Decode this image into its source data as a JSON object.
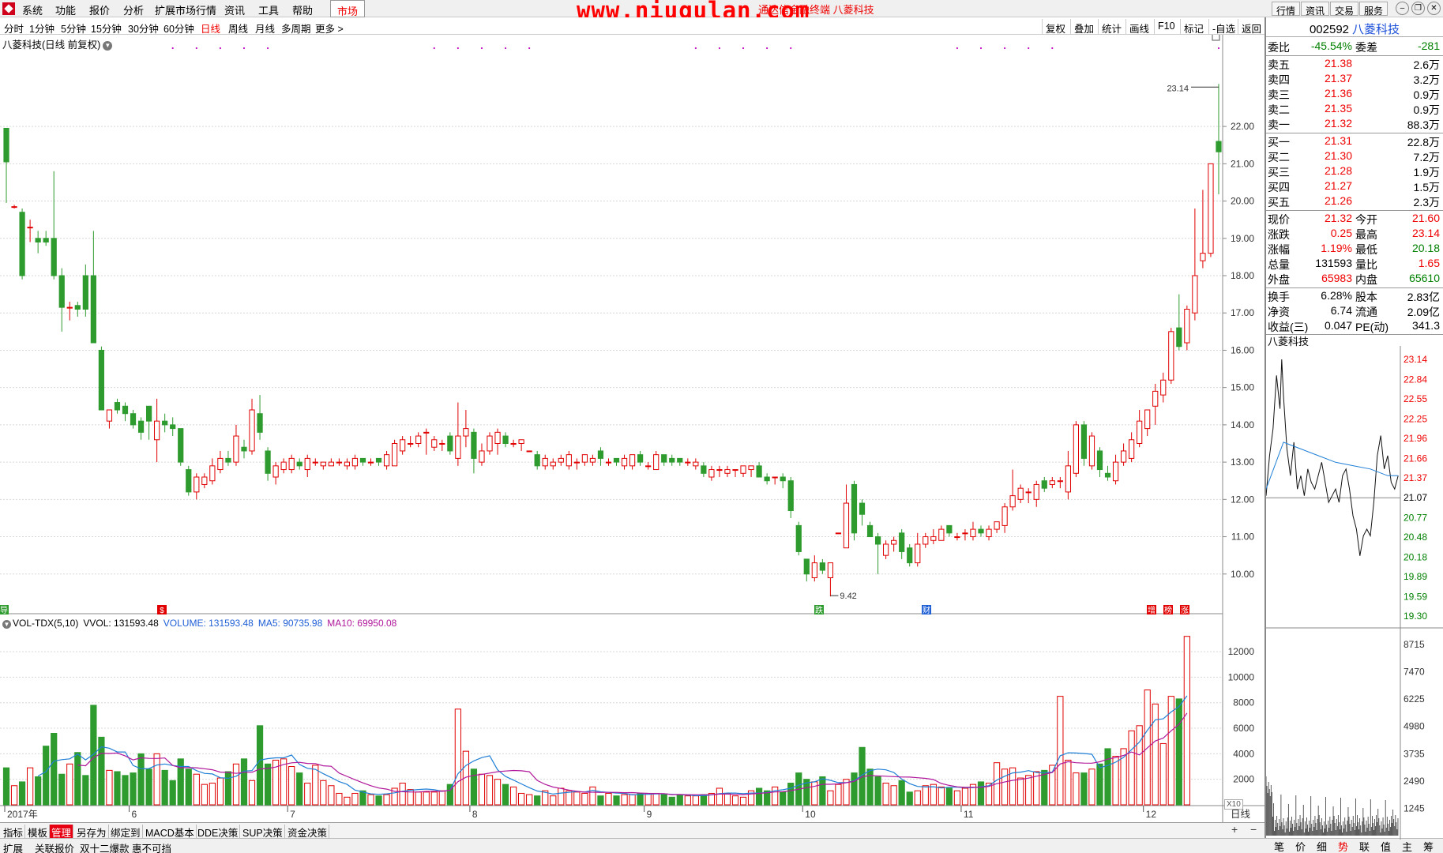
{
  "menu": {
    "items": [
      "系统",
      "功能",
      "报价",
      "分析",
      "扩展市场行情",
      "资讯",
      "工具",
      "帮助"
    ],
    "active": "市场",
    "watermark": "www.niugulan.com",
    "ticker": "通达信金融终端  八菱科技",
    "right_buttons": [
      "行情",
      "资讯",
      "交易",
      "服务"
    ]
  },
  "periods": {
    "items": [
      "分时",
      "1分钟",
      "5分钟",
      "15分钟",
      "30分钟",
      "60分钟",
      "日线",
      "周线",
      "月线",
      "多周期",
      "更多 >"
    ],
    "active": "日线"
  },
  "toolbar": [
    "复权",
    "叠加",
    "统计",
    "画线",
    "F10",
    "标记",
    "-自选",
    "返回"
  ],
  "chart": {
    "title": "八菱科技(日线 前复权)",
    "high_marker": "23.14",
    "low_marker": "9.42",
    "markers": {
      "left": "导",
      "s": "$",
      "die": "跌",
      "cai": "财",
      "zeng": "增",
      "bang": "榜",
      "zhang": "涨"
    },
    "price_ticks": [
      "22.00",
      "21.00",
      "20.00",
      "19.00",
      "18.00",
      "17.00",
      "16.00",
      "15.00",
      "14.00",
      "13.00",
      "12.00",
      "11.00",
      "10.00"
    ],
    "vol_ticks": [
      "12000",
      "10000",
      "8000",
      "6000",
      "4000",
      "2000"
    ],
    "vol_unit": "X10",
    "x_labels": [
      "2017年",
      "6",
      "7",
      "8",
      "9",
      "10",
      "11",
      "12"
    ],
    "x_axis_unit": "日线"
  },
  "volume_header": {
    "name": "VOL-TDX(5,10)",
    "vvol": "VVOL: 131593.48",
    "volume": "VOLUME: 131593.48",
    "ma5": "MA5: 90735.98",
    "ma10": "MA10: 69950.08"
  },
  "bottom_tabs": [
    "指标",
    "模板",
    "管理",
    "另存为",
    "绑定到",
    "MACD基本",
    "DDE决策",
    "SUP决策",
    "资金决策"
  ],
  "bottom_tabs_active": "管理",
  "status_items": [
    "扩展",
    "关联报价",
    "双十二爆款 惠不可挡"
  ],
  "quote": {
    "code": "002592",
    "name": "八菱科技",
    "weibi_label": "委比",
    "weibi": "-45.54%",
    "weicha_label": "委差",
    "weicha": "-281",
    "sells": [
      {
        "label": "卖五",
        "price": "21.38",
        "vol": "2.6万"
      },
      {
        "label": "卖四",
        "price": "21.37",
        "vol": "3.2万"
      },
      {
        "label": "卖三",
        "price": "21.36",
        "vol": "0.9万"
      },
      {
        "label": "卖二",
        "price": "21.35",
        "vol": "0.9万"
      },
      {
        "label": "卖一",
        "price": "21.32",
        "vol": "88.3万"
      }
    ],
    "buys": [
      {
        "label": "买一",
        "price": "21.31",
        "vol": "22.8万"
      },
      {
        "label": "买二",
        "price": "21.30",
        "vol": "7.2万"
      },
      {
        "label": "买三",
        "price": "21.28",
        "vol": "1.9万"
      },
      {
        "label": "买四",
        "price": "21.27",
        "vol": "1.5万"
      },
      {
        "label": "买五",
        "price": "21.26",
        "vol": "2.3万"
      }
    ],
    "stats": [
      {
        "l1": "现价",
        "v1": "21.32",
        "c1": "red",
        "l2": "今开",
        "v2": "21.60",
        "c2": "red"
      },
      {
        "l1": "涨跌",
        "v1": "0.25",
        "c1": "red",
        "l2": "最高",
        "v2": "23.14",
        "c2": "red"
      },
      {
        "l1": "涨幅",
        "v1": "1.19%",
        "c1": "red",
        "l2": "最低",
        "v2": "20.18",
        "c2": "green"
      },
      {
        "l1": "总量",
        "v1": "131593",
        "c1": "black",
        "l2": "量比",
        "v2": "1.65",
        "c2": "red"
      },
      {
        "l1": "外盘",
        "v1": "65983",
        "c1": "red",
        "l2": "内盘",
        "v2": "65610",
        "c2": "green"
      }
    ],
    "fund": [
      {
        "l1": "换手",
        "v1": "6.28%",
        "l2": "股本",
        "v2": "2.83亿"
      },
      {
        "l1": "净资",
        "v1": "6.74",
        "l2": "流通",
        "v2": "2.09亿"
      },
      {
        "l1": "收益(三)",
        "v1": "0.047",
        "l2": "PE(动)",
        "v2": "341.3"
      }
    ]
  },
  "intraday": {
    "title": "八菱科技",
    "price_ticks": [
      "23.14",
      "22.84",
      "22.55",
      "22.25",
      "21.96",
      "21.66",
      "21.37",
      "21.07",
      "20.77",
      "20.48",
      "20.18",
      "19.89",
      "19.59",
      "19.30"
    ],
    "vol_ticks": [
      "8715",
      "7470",
      "6225",
      "4980",
      "3735",
      "2490",
      "1245"
    ]
  },
  "intraday_tabs": [
    "笔",
    "价",
    "细",
    "势",
    "联",
    "值",
    "主",
    "筹"
  ],
  "intraday_tabs_active": "势",
  "colors": {
    "up": "#e00000",
    "down": "#2e9b2e",
    "ma5": "#1f7fd6",
    "ma10": "#b0179b",
    "accent": "#e60012"
  },
  "chart_data": {
    "type": "candlestick",
    "title": "八菱科技(日线 前复权)",
    "ylim": [
      9.0,
      23.4
    ],
    "x_months": [
      "2017年",
      "6",
      "7",
      "8",
      "9",
      "10",
      "11",
      "12"
    ],
    "candles": [
      [
        21.95,
        21.05,
        21.95,
        19.95
      ],
      [
        19.85,
        19.85,
        19.9,
        19.8
      ],
      [
        19.7,
        18.0,
        19.8,
        17.9
      ],
      [
        19.3,
        19.3,
        19.5,
        18.9
      ],
      [
        19.0,
        18.9,
        19.2,
        18.6
      ],
      [
        19.0,
        18.9,
        19.2,
        18.8
      ],
      [
        19.0,
        18.0,
        20.8,
        17.9
      ],
      [
        18.0,
        17.15,
        18.2,
        16.5
      ],
      [
        17.15,
        17.15,
        17.3,
        16.8
      ],
      [
        17.2,
        17.1,
        17.3,
        16.9
      ],
      [
        18.0,
        17.1,
        18.3,
        16.9
      ],
      [
        18.0,
        16.2,
        19.2,
        16.2
      ],
      [
        16.0,
        14.4,
        16.1,
        14.4
      ],
      [
        14.1,
        14.4,
        14.4,
        13.9
      ],
      [
        14.6,
        14.4,
        14.7,
        14.3
      ],
      [
        14.5,
        14.3,
        14.6,
        14.1
      ],
      [
        14.3,
        14.0,
        14.4,
        13.9
      ],
      [
        14.1,
        13.8,
        14.2,
        13.6
      ],
      [
        14.5,
        14.1,
        14.5,
        13.6
      ],
      [
        13.6,
        14.1,
        14.7,
        13.0
      ],
      [
        14.1,
        14.0,
        14.3,
        13.8
      ],
      [
        14.0,
        13.9,
        14.2,
        13.7
      ],
      [
        13.9,
        13.0,
        13.9,
        12.9
      ],
      [
        12.8,
        12.2,
        12.9,
        12.1
      ],
      [
        12.2,
        12.6,
        12.7,
        12.0
      ],
      [
        12.4,
        12.6,
        12.7,
        12.3
      ],
      [
        12.5,
        12.9,
        13.1,
        12.4
      ],
      [
        12.8,
        13.1,
        13.3,
        12.7
      ],
      [
        13.1,
        13.0,
        13.3,
        12.9
      ],
      [
        13.0,
        13.7,
        14.0,
        12.9
      ],
      [
        13.4,
        13.3,
        13.6,
        13.1
      ],
      [
        13.3,
        14.4,
        14.7,
        13.2
      ],
      [
        14.3,
        13.8,
        14.8,
        13.6
      ],
      [
        13.3,
        12.7,
        13.4,
        12.5
      ],
      [
        12.6,
        12.9,
        13.0,
        12.4
      ],
      [
        12.8,
        13.0,
        13.1,
        12.7
      ],
      [
        12.8,
        13.1,
        13.2,
        12.7
      ],
      [
        13.0,
        12.9,
        13.1,
        12.8
      ],
      [
        12.8,
        13.1,
        13.2,
        12.6
      ],
      [
        13.0,
        13.0,
        13.1,
        12.9
      ],
      [
        12.9,
        13.0,
        13.0,
        12.8
      ],
      [
        12.9,
        13.0,
        13.1,
        12.9
      ],
      [
        13.0,
        13.0,
        13.1,
        12.9
      ],
      [
        12.9,
        13.0,
        13.1,
        12.8
      ],
      [
        12.9,
        13.1,
        13.2,
        12.8
      ],
      [
        13.1,
        13.0,
        13.1,
        12.9
      ],
      [
        13.0,
        13.0,
        13.1,
        12.9
      ],
      [
        13.1,
        13.0,
        13.1,
        12.9
      ],
      [
        12.9,
        13.2,
        13.3,
        12.8
      ],
      [
        12.9,
        13.5,
        13.6,
        12.9
      ],
      [
        13.3,
        13.6,
        13.7,
        13.2
      ],
      [
        13.5,
        13.5,
        13.7,
        13.4
      ],
      [
        13.5,
        13.7,
        13.8,
        13.4
      ],
      [
        13.8,
        13.8,
        13.9,
        13.2
      ],
      [
        13.4,
        13.6,
        13.7,
        13.3
      ],
      [
        13.5,
        13.5,
        13.6,
        13.3
      ],
      [
        13.7,
        13.3,
        13.8,
        13.2
      ],
      [
        13.1,
        13.7,
        14.6,
        12.9
      ],
      [
        13.7,
        13.9,
        14.4,
        13.4
      ],
      [
        13.8,
        13.1,
        13.9,
        12.7
      ],
      [
        13.0,
        13.3,
        13.5,
        12.9
      ],
      [
        13.3,
        13.7,
        13.8,
        13.2
      ],
      [
        13.5,
        13.8,
        13.9,
        13.2
      ],
      [
        13.7,
        13.5,
        13.8,
        13.4
      ],
      [
        13.5,
        13.5,
        13.6,
        13.4
      ],
      [
        13.5,
        13.6,
        13.6,
        13.3
      ],
      [
        13.3,
        13.3,
        13.3,
        13.3
      ],
      [
        13.2,
        12.9,
        13.3,
        12.8
      ],
      [
        12.9,
        13.1,
        13.2,
        12.8
      ],
      [
        12.9,
        13.0,
        13.1,
        12.8
      ],
      [
        13.0,
        13.1,
        13.2,
        12.9
      ],
      [
        12.9,
        13.2,
        13.3,
        12.8
      ],
      [
        13.0,
        13.0,
        13.1,
        12.8
      ],
      [
        13.0,
        13.2,
        13.2,
        12.9
      ],
      [
        13.0,
        13.1,
        13.2,
        12.9
      ],
      [
        13.3,
        13.1,
        13.4,
        12.9
      ],
      [
        13.0,
        13.0,
        13.1,
        12.9
      ],
      [
        13.1,
        13.0,
        13.1,
        12.9
      ],
      [
        12.9,
        13.1,
        13.2,
        12.8
      ],
      [
        12.9,
        13.2,
        13.2,
        12.8
      ],
      [
        13.2,
        13.0,
        13.3,
        12.9
      ],
      [
        12.9,
        12.9,
        13.0,
        12.8
      ],
      [
        12.8,
        13.2,
        13.3,
        12.8
      ],
      [
        13.2,
        13.0,
        13.2,
        12.9
      ],
      [
        13.1,
        13.0,
        13.2,
        12.9
      ],
      [
        13.1,
        13.0,
        13.1,
        12.9
      ],
      [
        13.0,
        13.0,
        13.1,
        12.9
      ],
      [
        12.9,
        13.0,
        13.1,
        12.8
      ],
      [
        12.9,
        12.7,
        13.0,
        12.6
      ],
      [
        12.6,
        12.8,
        12.9,
        12.5
      ],
      [
        12.8,
        12.8,
        12.9,
        12.6
      ],
      [
        12.7,
        12.8,
        12.9,
        12.6
      ],
      [
        12.8,
        12.8,
        12.8,
        12.6
      ],
      [
        12.7,
        12.9,
        12.9,
        12.6
      ],
      [
        12.8,
        12.9,
        12.9,
        12.6
      ],
      [
        12.9,
        12.6,
        13.0,
        12.6
      ],
      [
        12.6,
        12.5,
        12.7,
        12.4
      ],
      [
        12.6,
        12.6,
        12.6,
        12.4
      ],
      [
        12.6,
        12.5,
        12.7,
        12.3
      ],
      [
        12.5,
        11.7,
        12.6,
        11.5
      ],
      [
        11.3,
        10.6,
        11.4,
        10.5
      ],
      [
        10.4,
        10.0,
        10.4,
        9.8
      ],
      [
        9.9,
        10.3,
        10.5,
        9.8
      ],
      [
        10.3,
        10.1,
        10.4,
        10.0
      ],
      [
        9.9,
        10.3,
        10.3,
        9.4
      ],
      [
        11.1,
        11.1,
        11.1,
        11.1
      ],
      [
        10.7,
        11.9,
        12.4,
        10.7
      ],
      [
        12.4,
        11.1,
        12.5,
        10.9
      ],
      [
        11.9,
        11.6,
        12.0,
        11.3
      ],
      [
        11.3,
        11.0,
        11.4,
        11.0
      ],
      [
        11.0,
        10.8,
        11.1,
        10.0
      ],
      [
        10.5,
        10.8,
        10.9,
        10.4
      ],
      [
        10.8,
        10.9,
        11.0,
        10.6
      ],
      [
        11.1,
        10.6,
        11.2,
        10.4
      ],
      [
        10.7,
        10.3,
        10.8,
        10.2
      ],
      [
        10.3,
        10.8,
        11.1,
        10.2
      ],
      [
        10.8,
        11.0,
        11.1,
        10.7
      ],
      [
        10.9,
        11.0,
        11.2,
        10.8
      ],
      [
        10.9,
        11.2,
        11.3,
        10.9
      ],
      [
        11.3,
        11.1,
        11.3,
        11.0
      ],
      [
        11.0,
        11.0,
        11.1,
        10.9
      ],
      [
        11.1,
        11.1,
        11.2,
        10.9
      ],
      [
        11.0,
        11.2,
        11.4,
        10.9
      ],
      [
        11.2,
        11.1,
        11.3,
        11.0
      ],
      [
        11.0,
        11.2,
        11.3,
        10.9
      ],
      [
        11.2,
        11.4,
        11.4,
        11.1
      ],
      [
        11.3,
        11.8,
        11.9,
        11.1
      ],
      [
        11.8,
        12.1,
        12.8,
        11.7
      ],
      [
        12.0,
        12.3,
        12.4,
        11.9
      ],
      [
        12.2,
        12.2,
        12.3,
        11.9
      ],
      [
        12.0,
        12.4,
        12.5,
        11.8
      ],
      [
        12.5,
        12.3,
        12.6,
        12.2
      ],
      [
        12.4,
        12.5,
        12.6,
        12.3
      ],
      [
        12.5,
        12.5,
        12.6,
        12.3
      ],
      [
        12.2,
        12.9,
        13.3,
        12.0
      ],
      [
        12.7,
        14.0,
        14.1,
        12.6
      ],
      [
        14.0,
        13.1,
        14.1,
        12.9
      ],
      [
        12.9,
        13.7,
        13.8,
        12.8
      ],
      [
        13.3,
        12.8,
        13.4,
        12.6
      ],
      [
        12.7,
        12.6,
        12.9,
        12.5
      ],
      [
        12.5,
        13.0,
        13.2,
        12.4
      ],
      [
        13.0,
        13.3,
        13.5,
        12.9
      ],
      [
        13.1,
        13.6,
        13.8,
        13.0
      ],
      [
        13.5,
        14.1,
        14.4,
        13.4
      ],
      [
        13.9,
        14.4,
        14.4,
        13.7
      ],
      [
        14.5,
        14.9,
        15.1,
        14.0
      ],
      [
        14.8,
        15.2,
        15.4,
        14.6
      ],
      [
        15.2,
        16.5,
        16.6,
        15.1
      ],
      [
        16.6,
        16.1,
        17.5,
        16.0
      ],
      [
        16.2,
        17.1,
        17.2,
        16.0
      ],
      [
        17.0,
        18.0,
        19.8,
        16.8
      ],
      [
        18.4,
        18.6,
        20.3,
        18.2
      ],
      [
        18.6,
        21.0,
        21.0,
        18.5
      ],
      [
        21.6,
        21.32,
        23.14,
        20.18
      ]
    ],
    "volume": [
      2900,
      1500,
      1800,
      2900,
      2200,
      4600,
      5600,
      2400,
      3200,
      4100,
      2300,
      7800,
      5300,
      2700,
      2600,
      2300,
      2500,
      4000,
      2800,
      4000,
      2700,
      1900,
      3600,
      2800,
      2400,
      1600,
      1700,
      2100,
      2600,
      3200,
      3600,
      1900,
      6200,
      3200,
      3500,
      3600,
      3000,
      2500,
      1700,
      3100,
      1900,
      1500,
      900,
      600,
      900,
      1100,
      800,
      700,
      800,
      1300,
      1700,
      1200,
      1000,
      1000,
      1000,
      1100,
      1600,
      7500,
      4200,
      2800,
      2400,
      2300,
      2000,
      1600,
      1400,
      900,
      800,
      700,
      1100,
      700,
      1300,
      1100,
      1000,
      900,
      1400,
      700,
      900,
      700,
      800,
      800,
      900,
      900,
      900,
      800,
      600,
      800,
      700,
      700,
      800,
      900,
      1300,
      900,
      700,
      600,
      1100,
      1300,
      1100,
      1400,
      1000,
      1700,
      2500,
      2000,
      1800,
      2200,
      1100,
      1600,
      2000,
      2500,
      4500,
      2800,
      2200,
      1700,
      1500,
      1900,
      1000,
      1100,
      1500,
      1600,
      1400,
      1300,
      1100,
      1300,
      1600,
      1800,
      1700,
      3300,
      2800,
      2900,
      2100,
      2300,
      2600,
      2700,
      3100,
      8500,
      3500,
      2500,
      2500,
      2800,
      3200,
      4400,
      3800,
      4400,
      5800,
      6200,
      9000,
      7900,
      4800,
      8500,
      8300,
      13200
    ]
  }
}
